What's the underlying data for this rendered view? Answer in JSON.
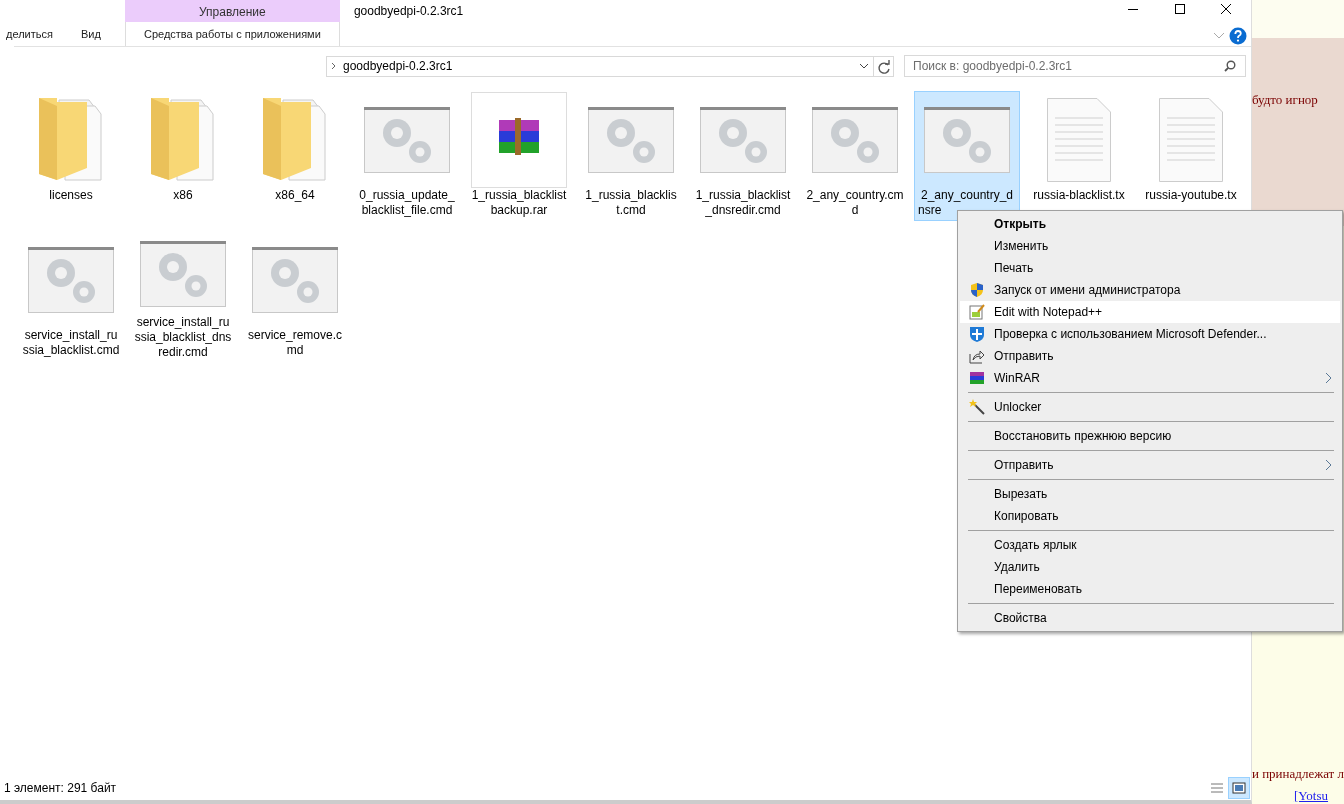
{
  "window": {
    "title": "goodbyedpi-0.2.3rc1"
  },
  "ribbon": {
    "context_group": "Управление",
    "tabs": [
      {
        "label": "делиться",
        "selected": false
      },
      {
        "label": "Вид",
        "selected": false
      },
      {
        "label": "Средства работы с приложениями",
        "selected": false,
        "kind": "context"
      }
    ]
  },
  "address": {
    "path": "goodbyedpi-0.2.3rc1"
  },
  "search": {
    "placeholder": "Поиск в: goodbyedpi-0.2.3rc1"
  },
  "files": [
    {
      "name": "licenses",
      "kind": "folder",
      "selected": false
    },
    {
      "name": "x86",
      "kind": "folder",
      "selected": false
    },
    {
      "name": "x86_64",
      "kind": "folder",
      "selected": false
    },
    {
      "name": "0_russia_update_blacklist_file.cmd",
      "kind": "cmd",
      "selected": false
    },
    {
      "name": "1_russia_blacklist backup.rar",
      "kind": "rar",
      "selected": false
    },
    {
      "name": "1_russia_blacklist.cmd",
      "kind": "cmd",
      "selected": false
    },
    {
      "name": "1_russia_blacklist_dnsredir.cmd",
      "kind": "cmd",
      "selected": false
    },
    {
      "name": "2_any_country.cmd",
      "kind": "cmd",
      "selected": false
    },
    {
      "name": "2_any_country_dnsre",
      "kind": "cmd",
      "selected": true
    },
    {
      "name": "russia-blacklist.tx",
      "kind": "txt",
      "selected": false
    },
    {
      "name": "russia-youtube.tx",
      "kind": "txt",
      "selected": false
    },
    {
      "name": "service_install_russia_blacklist.cmd",
      "kind": "cmd",
      "selected": false
    },
    {
      "name": "service_install_russia_blacklist_dnsredir.cmd",
      "kind": "cmd",
      "selected": false
    },
    {
      "name": "service_remove.cmd",
      "kind": "cmd",
      "selected": false
    }
  ],
  "status_bar": {
    "text": "1 элемент: 291 байт",
    "views": [
      {
        "selected": false
      },
      {
        "selected": true
      }
    ]
  },
  "context_menu": [
    {
      "kind": "item",
      "label": "Открыть",
      "default": true,
      "highlighted": false
    },
    {
      "kind": "item",
      "label": "Изменить",
      "default": false,
      "highlighted": false
    },
    {
      "kind": "item",
      "label": "Печать",
      "default": false,
      "highlighted": false
    },
    {
      "kind": "item",
      "label": "Запуск от имени администратора",
      "default": false,
      "highlighted": false
    },
    {
      "kind": "item",
      "label": "Edit with Notepad++",
      "default": false,
      "highlighted": true
    },
    {
      "kind": "item",
      "label": "Проверка с использованием Microsoft Defender...",
      "default": false,
      "highlighted": false
    },
    {
      "kind": "item",
      "label": "Отправить",
      "default": false,
      "highlighted": false
    },
    {
      "kind": "item",
      "label": "WinRAR",
      "default": false,
      "highlighted": false,
      "submenu": true
    },
    {
      "kind": "separator"
    },
    {
      "kind": "item",
      "label": "Unlocker",
      "default": false,
      "highlighted": false
    },
    {
      "kind": "separator"
    },
    {
      "kind": "item",
      "label": "Восстановить прежнюю версию",
      "default": false,
      "highlighted": false
    },
    {
      "kind": "separator"
    },
    {
      "kind": "item",
      "label": "Отправить",
      "default": false,
      "highlighted": false,
      "submenu": true
    },
    {
      "kind": "separator"
    },
    {
      "kind": "item",
      "label": "Вырезать",
      "default": false,
      "highlighted": false
    },
    {
      "kind": "item",
      "label": "Копировать",
      "default": false,
      "highlighted": false
    },
    {
      "kind": "separator"
    },
    {
      "kind": "item",
      "label": "Создать ярлык",
      "default": false,
      "highlighted": false
    },
    {
      "kind": "item",
      "label": "Удалить",
      "default": false,
      "highlighted": false
    },
    {
      "kind": "item",
      "label": "Переименовать",
      "default": false,
      "highlighted": false
    },
    {
      "kind": "separator"
    },
    {
      "kind": "item",
      "label": "Свойства",
      "default": false,
      "highlighted": false
    }
  ],
  "background_page": {
    "texts": [
      "будто игнор",
      "и принадлежат л"
    ],
    "link": "[Yotsu"
  }
}
